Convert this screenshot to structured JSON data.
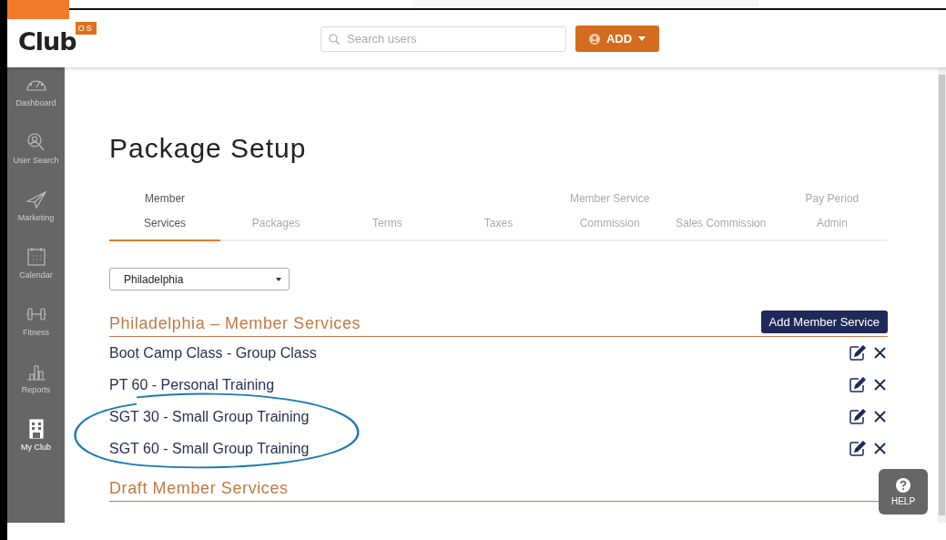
{
  "logo": {
    "text": "Club",
    "badge": "OS"
  },
  "search": {
    "placeholder": "Search users"
  },
  "add_button": {
    "label": "ADD"
  },
  "sidebar": {
    "items": [
      {
        "label": "Dashboard",
        "selected": false
      },
      {
        "label": "User Search",
        "selected": false
      },
      {
        "label": "Marketing",
        "selected": false
      },
      {
        "label": "Calendar",
        "selected": false
      },
      {
        "label": "Fitness",
        "selected": false
      },
      {
        "label": "Reports",
        "selected": false
      },
      {
        "label": "My Club",
        "selected": true
      }
    ]
  },
  "page_title": "Package Setup",
  "tabs": [
    {
      "lines": [
        "Member",
        "Services"
      ],
      "selected": true
    },
    {
      "lines": [
        "Packages"
      ],
      "selected": false
    },
    {
      "lines": [
        "Terms"
      ],
      "selected": false
    },
    {
      "lines": [
        "Taxes"
      ],
      "selected": false
    },
    {
      "lines": [
        "Member Service",
        "Commission"
      ],
      "selected": false
    },
    {
      "lines": [
        "Sales Commission"
      ],
      "selected": false
    },
    {
      "lines": [
        "Pay Period",
        "Admin"
      ],
      "selected": false
    }
  ],
  "location_select": {
    "value": "Philadelphia"
  },
  "sections": [
    {
      "title": "Philadelphia – Member Services",
      "button": "Add Member Service",
      "items": [
        "Boot Camp Class - Group Class",
        "PT 60 - Personal Training",
        "SGT 30 - Small Group Training",
        "SGT 60 - Small Group Training"
      ]
    },
    {
      "title": "Draft Member Services"
    }
  ],
  "help_button": {
    "label": "HELP"
  }
}
